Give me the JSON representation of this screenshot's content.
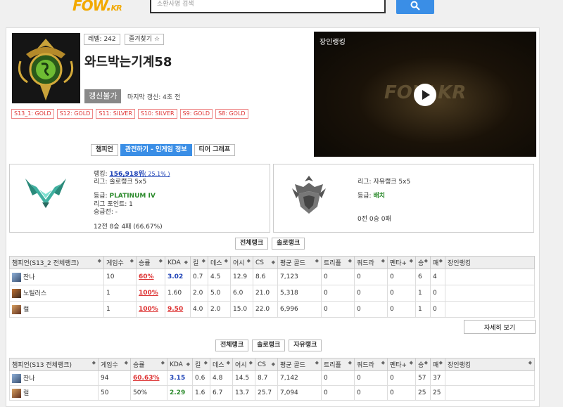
{
  "header": {
    "logo": "FOW.",
    "logo_suffix": "KR",
    "search_placeholder": "소환사명 검색"
  },
  "profile": {
    "level": "레벨: 242",
    "favorite": "즐겨찾기 ☆",
    "name": "와드박는기계58",
    "refresh_label": "갱신불가",
    "last_update": "마지막 갱신: 4초 전",
    "seasons": [
      "S13_1: GOLD",
      "S12: GOLD",
      "S11: SILVER",
      "S10: SILVER",
      "S9: GOLD",
      "S8: GOLD"
    ]
  },
  "video": {
    "title": "장인랭킹",
    "logo": "FOW.KR"
  },
  "tabs": [
    "챔피언",
    "관전하기 - 인게임 정보",
    "티어 그래프"
  ],
  "solo": {
    "rank_label": "랭킹:",
    "rank_value": "156,918위",
    "rank_percent": "( 25.1% )",
    "league": "리그: 솔로랭크 5x5",
    "tier_label": "등급:",
    "tier_value": "PLATINUM IV",
    "points": "리그 포인트: 1",
    "promo": "승급전: -",
    "record": "12전 8승 4패 (66.67%)"
  },
  "flex": {
    "league": "리그: 자유랭크 5x5",
    "tier_label": "등급:",
    "tier_value": "배치",
    "record": "0전 0승 0패"
  },
  "table1_buttons": [
    "전체랭크",
    "솔로랭크"
  ],
  "table1": {
    "headers": [
      "챔피언(S13_2 전체랭크)",
      "게임수",
      "승률",
      "KDA",
      "킬",
      "데스",
      "어시",
      "CS",
      "평균 골드",
      "트리플",
      "쿼드라",
      "펜타+",
      "승",
      "패",
      "장인랭킹"
    ],
    "rows": [
      {
        "champ": "잔나",
        "games": "10",
        "wr": "60%",
        "kda": "3.02",
        "k": "0.7",
        "d": "4.5",
        "a": "12.9",
        "cs": "8.6",
        "gold": "7,123",
        "t": "0",
        "q": "0",
        "p": "0",
        "w": "6",
        "l": "4",
        "rank": ""
      },
      {
        "champ": "노틸러스",
        "games": "1",
        "wr": "100%",
        "kda": "1.60",
        "k": "2.0",
        "d": "5.0",
        "a": "6.0",
        "cs": "21.0",
        "gold": "5,318",
        "t": "0",
        "q": "0",
        "p": "0",
        "w": "1",
        "l": "0",
        "rank": ""
      },
      {
        "champ": "럴",
        "games": "1",
        "wr": "100%",
        "kda": "9.50",
        "k": "4.0",
        "d": "2.0",
        "a": "15.0",
        "cs": "22.0",
        "gold": "6,996",
        "t": "0",
        "q": "0",
        "p": "0",
        "w": "1",
        "l": "0",
        "rank": ""
      }
    ]
  },
  "detail_button": "자세히 보기",
  "table2_buttons": [
    "전체랭크",
    "솔로랭크",
    "자유랭크"
  ],
  "table2": {
    "headers": [
      "챔피언(S13 전체랭크)",
      "게임수",
      "승률",
      "KDA",
      "킬",
      "데스",
      "어시",
      "CS",
      "평균 골드",
      "트리플",
      "쿼드라",
      "펜타+",
      "승",
      "패",
      "장인랭킹"
    ],
    "rows": [
      {
        "champ": "잔나",
        "games": "94",
        "wr": "60.63%",
        "kda": "3.15",
        "k": "0.6",
        "d": "4.8",
        "a": "14.5",
        "cs": "8.7",
        "gold": "7,142",
        "t": "0",
        "q": "0",
        "p": "0",
        "w": "57",
        "l": "37",
        "rank": ""
      },
      {
        "champ": "럴",
        "games": "50",
        "wr": "50%",
        "kda": "2.29",
        "k": "1.6",
        "d": "6.7",
        "a": "13.7",
        "cs": "25.7",
        "gold": "7,094",
        "t": "0",
        "q": "0",
        "p": "0",
        "w": "25",
        "l": "25",
        "rank": ""
      }
    ]
  }
}
